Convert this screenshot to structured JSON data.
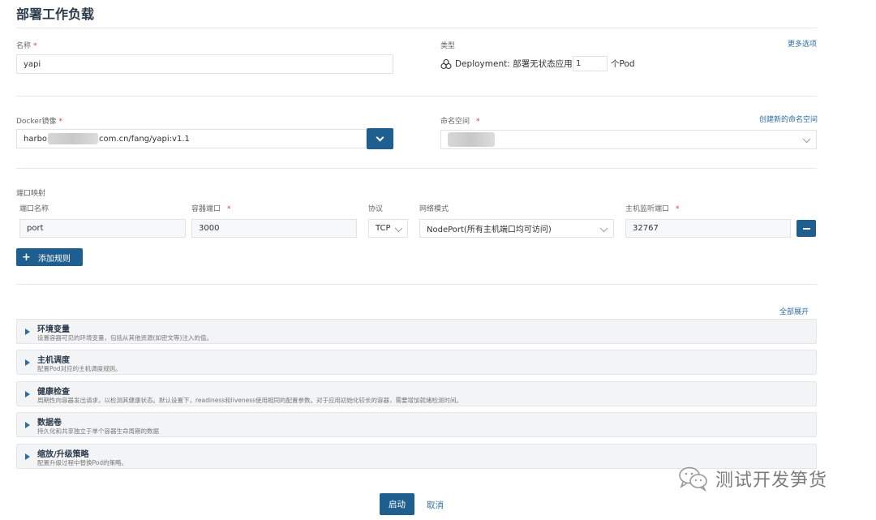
{
  "page": {
    "title": "部署工作负载"
  },
  "name_field": {
    "label": "名称",
    "required_mark": "*",
    "value": "yapi"
  },
  "type_field": {
    "label": "类型",
    "more_options": "更多选项",
    "icon": "deployment-icon",
    "text": "Deployment: 部署无状态应用",
    "replicas": "1",
    "unit": "个Pod"
  },
  "image_field": {
    "label": "Docker镜像",
    "required_mark": "*",
    "value_prefix": "harbo",
    "value_suffix": "com.cn/fang/yapi:v1.1"
  },
  "namespace_field": {
    "label": "命名空间",
    "required_mark": "*",
    "create_link": "创建新的命名空间"
  },
  "ports": {
    "section_label": "端口映射",
    "headers": {
      "name": "端口名称",
      "container_port": "容器端口",
      "protocol": "协议",
      "network_mode": "网络模式",
      "host_port": "主机监听端口"
    },
    "required_mark": "*",
    "row": {
      "name": "port",
      "container_port": "3000",
      "protocol": "TCP",
      "network_mode": "NodePort(所有主机端口均可访问)",
      "host_port": "32767"
    },
    "add_rule": "添加规则"
  },
  "expand_all": "全部展开",
  "sections": [
    {
      "title": "环境变量",
      "desc": "设置容器可见的环境变量，包括从其他资源(如密文等)注入的值。"
    },
    {
      "title": "主机调度",
      "desc": "配置Pod对应的主机调度规则。"
    },
    {
      "title": "健康检查",
      "desc": "周期性向容器发出请求，以检测其健康状态。默认设置下，readiness和liveness使用相同的配置参数。对于应用初始化较长的容器，需要增加就绪检测时间。"
    },
    {
      "title": "数据卷",
      "desc": "持久化和共享独立于单个容器生命周期的数据"
    },
    {
      "title": "缩放/升级策略",
      "desc": "配置升级过程中替换Pod的策略。"
    }
  ],
  "actions": {
    "launch": "启动",
    "cancel": "取消"
  },
  "watermark": {
    "text": "测试开发笋货",
    "icon": "wechat-icon"
  },
  "colors": {
    "accent": "#1f5f8f",
    "link": "#2d6da3",
    "required": "#e53935"
  }
}
